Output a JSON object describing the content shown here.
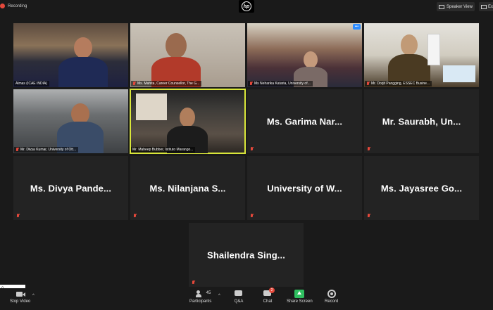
{
  "topbar": {
    "recording_label": "Recording",
    "brand_logo": "hp",
    "speaker_view_label": "Speaker View",
    "exit_label": "Ex"
  },
  "tiles": {
    "t1": "Almas  (ICAE INDIA)",
    "t2": "Ms. Mahita, Career Counsellor, The G...",
    "t3": "Ms Neharika Kataria, University of...",
    "t4": "Mr. Dorjit Pangging, ESSEC Busine...",
    "t5": "Mr. Divya Kumar, University of Ott...",
    "t6": "Mr. Maheep Bubber, Istituto Marango...",
    "t7": "Ms. Garima Nar...",
    "t8": "Mr. Saurabh, Un...",
    "t9": "Ms. Divya Pande...",
    "t10": "Ms. Nilanjana S...",
    "t11": "University of W...",
    "t12": "Ms. Jayasree Go...",
    "t13": "Shailendra Sing..."
  },
  "more_button": "•••",
  "toolbar": {
    "stop_video": "Stop Video",
    "participants": "Participants",
    "participants_count": "45",
    "qa": "Q&A",
    "chat": "Chat",
    "chat_badge": "2",
    "share_screen": "Share Screen",
    "record": "Record",
    "left_box_value": "0"
  },
  "colors": {
    "active_speaker": "#d9e63a",
    "muted": "#e5483b",
    "share_green": "#2fbf5f"
  }
}
